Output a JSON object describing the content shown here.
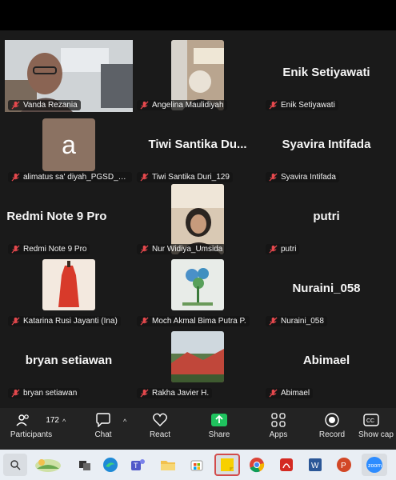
{
  "participants": [
    {
      "name": "Vanda Rezania",
      "muted": true,
      "kind": "video",
      "active": true
    },
    {
      "name": "Angelina Maulidiyah",
      "muted": true,
      "kind": "video"
    },
    {
      "name": "Enik Setiyawati",
      "muted": true,
      "kind": "name"
    },
    {
      "name": "alimatus sa' diyah_PGSD_U...",
      "muted": true,
      "kind": "avatar",
      "initial": "a"
    },
    {
      "name": "Tiwi Santika Duri_129",
      "display": "Tiwi Santika Du...",
      "muted": true,
      "kind": "name"
    },
    {
      "name": "Syavira Intifada",
      "muted": true,
      "kind": "name"
    },
    {
      "name": "Redmi Note 9 Pro",
      "display": ". Redmi Note 9 Pro",
      "muted": true,
      "kind": "name"
    },
    {
      "name": "Nur Widiya_Umsida",
      "muted": true,
      "kind": "video"
    },
    {
      "name": "putri",
      "muted": true,
      "kind": "name"
    },
    {
      "name": "Katarina Rusi Jayanti (Ina)",
      "muted": true,
      "kind": "image"
    },
    {
      "name": "Moch Akmal Bima Putra P.",
      "muted": true,
      "kind": "image"
    },
    {
      "name": "Nuraini_058",
      "muted": true,
      "kind": "name"
    },
    {
      "name": "bryan setiawan",
      "muted": true,
      "kind": "name"
    },
    {
      "name": "Rakha Javier H.",
      "muted": true,
      "kind": "image"
    },
    {
      "name": "Abimael",
      "muted": true,
      "kind": "name"
    }
  ],
  "toolbar": {
    "participants_label": "Participants",
    "participants_count": "172",
    "chat_label": "Chat",
    "react_label": "React",
    "share_label": "Share",
    "apps_label": "Apps",
    "record_label": "Record",
    "show_captions_label": "Show cap"
  },
  "colors": {
    "active_speaker": "#1fd36a",
    "share_green": "#1fc35e",
    "muted_red": "#e5484d",
    "tile_bg": "#1a1a1a",
    "toolbar_bg": "#232323"
  },
  "taskbar": {
    "icons": [
      "weather-icon",
      "task-view-icon",
      "edge-icon",
      "teams-icon",
      "file-explorer-icon",
      "store-icon",
      "sticky-notes-icon",
      "chrome-icon",
      "acrobat-icon",
      "word-icon",
      "powerpoint-icon",
      "zoom-icon"
    ]
  }
}
